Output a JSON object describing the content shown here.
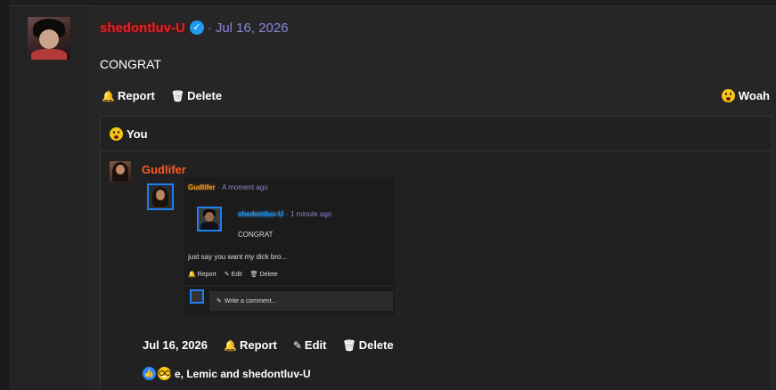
{
  "post": {
    "username": "shedontluv-U",
    "date": "Jul 16, 2026",
    "separator": "·",
    "body": "CONGRAT",
    "actions": {
      "report": "Report",
      "delete": "Delete"
    },
    "top_reaction": {
      "label": "Woah"
    }
  },
  "reply": {
    "reaction_label": "You",
    "username": "Gudlifer",
    "embed": {
      "username": "Gudlifer",
      "time": "· A moment ago",
      "nested": {
        "username": "shedontluv-U",
        "time": "· 1 minute ago",
        "body": "CONGRAT"
      },
      "body": "just say you want my dick bro...",
      "actions": {
        "report": "Report",
        "edit": "Edit",
        "delete": "Delete"
      },
      "comment_placeholder": "Write a comment..."
    },
    "footer": {
      "date": "Jul 16, 2026",
      "report": "Report",
      "edit": "Edit",
      "delete": "Delete"
    },
    "reactions_text": "e, Lemic and shedontluv-U"
  },
  "icons": {
    "bell": "🔔",
    "trash": "🗑",
    "pencil": "✎",
    "check": "✓",
    "thumbs_up": "👍"
  },
  "colors": {
    "username_main": "#e4242a",
    "date": "#8783d6",
    "reply_username": "#ff5a1f",
    "embed_username": "#f0a020",
    "nested_username": "#1d8fe0",
    "verified": "#1d9bf0",
    "like": "#2d88ff"
  }
}
